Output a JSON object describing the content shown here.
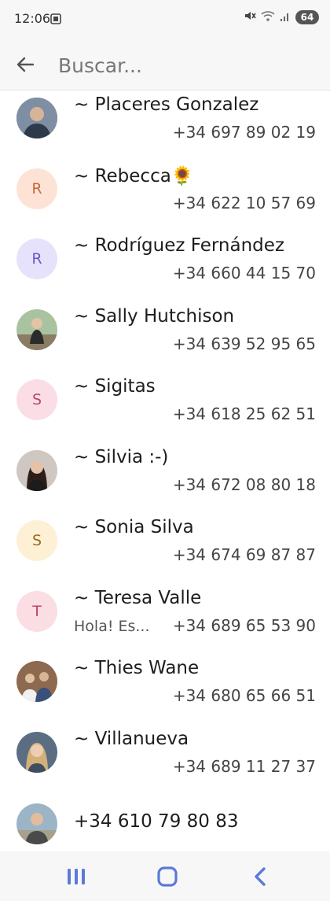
{
  "status": {
    "time": "12:06",
    "battery": "64"
  },
  "search": {
    "placeholder": "Buscar..."
  },
  "contacts": [
    {
      "name": "~ Placeres Gonzalez",
      "phone": "+34 697 89 02 19",
      "avatar": {
        "type": "photo",
        "icon": "person-photo-icon"
      }
    },
    {
      "name": "~ Rebecca🌻",
      "phone": "+34 622 10 57 69",
      "avatar": {
        "type": "letter",
        "letter": "R",
        "bg": "#fde3d6",
        "fg": "#c6683e"
      }
    },
    {
      "name": "~ Rodríguez Fernández",
      "phone": "+34 660 44 15 70",
      "avatar": {
        "type": "letter",
        "letter": "R",
        "bg": "#e7e2fb",
        "fg": "#6a56c8"
      }
    },
    {
      "name": "~ Sally Hutchison",
      "phone": "+34 639 52 95 65",
      "avatar": {
        "type": "photo",
        "icon": "person-photo-icon"
      }
    },
    {
      "name": "~ Sigitas",
      "phone": "+34 618 25 62 51",
      "avatar": {
        "type": "letter",
        "letter": "S",
        "bg": "#fbdde6",
        "fg": "#b64a72"
      }
    },
    {
      "name": "~ Silvia  :-)",
      "phone": "+34 672 08 80 18",
      "avatar": {
        "type": "photo",
        "icon": "person-photo-icon"
      }
    },
    {
      "name": "~ Sonia Silva",
      "phone": "+34 674 69 87 87",
      "avatar": {
        "type": "letter",
        "letter": "S",
        "bg": "#fdf0d5",
        "fg": "#9a6a20"
      }
    },
    {
      "name": "~ Teresa Valle",
      "phone": "+34 689 65 53 90",
      "preview": "Hola! Es...",
      "avatar": {
        "type": "letter",
        "letter": "T",
        "bg": "#fbdde4",
        "fg": "#c14560"
      }
    },
    {
      "name": "~ Thies Wane",
      "phone": "+34 680 65 66 51",
      "avatar": {
        "type": "photo",
        "icon": "group-photo-icon"
      }
    },
    {
      "name": "~ Villanueva",
      "phone": "+34 689 11 27 37",
      "avatar": {
        "type": "photo",
        "icon": "person-photo-icon"
      }
    },
    {
      "name": "+34 610 79 80 83",
      "phone": "",
      "avatar": {
        "type": "photo",
        "icon": "person-photo-icon"
      }
    }
  ]
}
